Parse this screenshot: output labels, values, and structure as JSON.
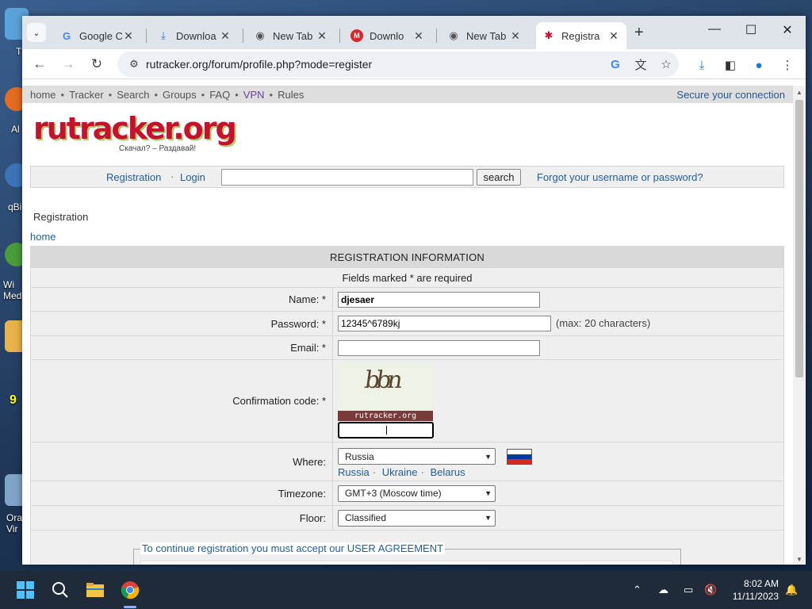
{
  "desktop": {
    "icons": [
      {
        "label": "T"
      },
      {
        "label": "Al"
      },
      {
        "label": "qBi"
      },
      {
        "label": "Wi\nMed"
      },
      {
        "label": "9"
      },
      {
        "label": "Ora\nVir"
      }
    ]
  },
  "browser": {
    "tabs": [
      {
        "title": "Google C",
        "icon": "google-icon",
        "active": false
      },
      {
        "title": "Downloa",
        "icon": "download-icon",
        "active": false
      },
      {
        "title": "New Tab",
        "icon": "chrome-icon",
        "active": false
      },
      {
        "title": "Downlo",
        "icon": "mega-icon",
        "active": false
      },
      {
        "title": "New Tab",
        "icon": "chrome-icon",
        "active": false
      },
      {
        "title": "Registra",
        "icon": "rutracker-icon",
        "active": true
      }
    ],
    "url": "rutracker.org/forum/profile.php?mode=register"
  },
  "page": {
    "topnav": {
      "items": [
        "home",
        "Tracker",
        "Search",
        "Groups",
        "FAQ",
        "VPN",
        "Rules"
      ],
      "secure": "Secure your connection"
    },
    "logo": {
      "text": "rutracker.org",
      "tagline": "Скачал? – Раздавай!"
    },
    "loginbar": {
      "registration": "Registration",
      "login": "Login",
      "search_label": "search",
      "forgot": "Forgot your username or password?"
    },
    "breadcrumb_title": "Registration",
    "home_link": "home",
    "form": {
      "header": "REGISTRATION INFORMATION",
      "required_note": "Fields marked * are required",
      "name_label": "Name: *",
      "name_value": "djesaer",
      "password_label": "Password: *",
      "password_value": "12345^6789kj",
      "password_hint": "(max: 20 characters)",
      "email_label": "Email: *",
      "email_value": "",
      "confirm_label": "Confirmation code: *",
      "captcha_text": "bbn",
      "captcha_brand": "rutracker.org",
      "where_label": "Where:",
      "where_value": "Russia",
      "countries": [
        "Russia",
        "Ukraine",
        "Belarus"
      ],
      "timezone_label": "Timezone:",
      "timezone_value": "GMT+3 (Moscow time)",
      "floor_label": "Floor:",
      "floor_value": "Classified",
      "agreement_legend": "To continue registration you must accept our USER AGREEMENT"
    }
  },
  "taskbar": {
    "time": "8:02 AM",
    "date": "11/11/2023"
  },
  "colors": {
    "link": "#1f5e9e",
    "header_bg": "#d9d9d9",
    "row_bg": "#efefef",
    "logo_red": "#c8102e",
    "logo_green": "#9bd26a"
  }
}
